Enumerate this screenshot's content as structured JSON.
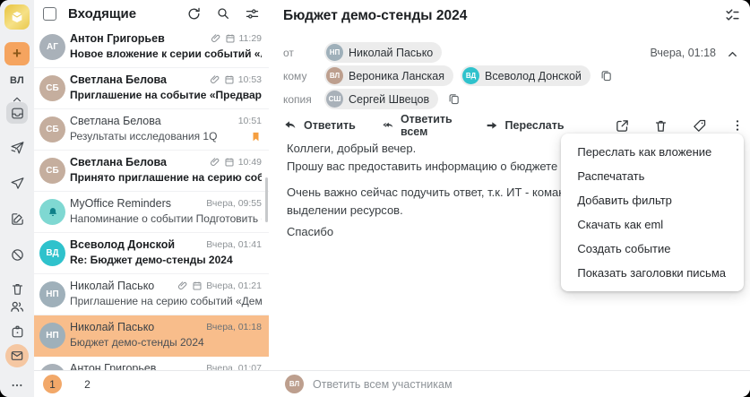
{
  "colors": {
    "accent_orange": "#f2a45f",
    "selected_row": "#f8bd8b",
    "teal_avatar": "#2fc2cc",
    "flag_orange": "#f59f40",
    "reminder_bg": "#7fd8d2",
    "pagination_active": "#f2a869"
  },
  "sidebar": {
    "compose": "+",
    "account_initials": "ВЛ"
  },
  "list": {
    "title": "Входящие",
    "emails": [
      {
        "name": "Антон Григорьев",
        "time": "11:29",
        "subject": "Новое вложение к серии событий «Аналити...",
        "unread": true,
        "attachment": true,
        "event": true,
        "avatar": "АГ"
      },
      {
        "name": "Светлана Белова",
        "time": "10:53",
        "subject": "Приглашение на событие «Предварительно...",
        "unread": true,
        "attachment": true,
        "event": true,
        "avatar": "СБ"
      },
      {
        "name": "Светлана Белова",
        "time": "10:51",
        "subject": "Результаты исследования 1Q",
        "unread": false,
        "flagged": true,
        "avatar": "СБ"
      },
      {
        "name": "Светлана Белова",
        "time": "10:49",
        "subject": "Принято приглашение на серию событий «...",
        "unread": true,
        "attachment": true,
        "event": true,
        "avatar": "СБ"
      },
      {
        "name": "MyOffice Reminders",
        "time": "Вчера, 09:55",
        "subject": "Напоминание о событии Подготовить отчет...",
        "unread": false,
        "avatar": "bell"
      },
      {
        "name": "Всеволод Донской",
        "time": "Вчера, 01:41",
        "subject": "Re: Бюджет демо-стенды 2024",
        "unread": true,
        "avatar": "ВД"
      },
      {
        "name": "Николай Пасько",
        "time": "Вчера, 01:21",
        "subject": "Приглашение на серию событий «Демо стен...",
        "unread": false,
        "attachment": true,
        "event": true,
        "avatar": "НП"
      },
      {
        "name": "Николай Пасько",
        "time": "Вчера, 01:18",
        "subject": "Бюджет демо-стенды 2024",
        "unread": false,
        "selected": true,
        "avatar": "НП"
      },
      {
        "name": "Антон Григорьев",
        "time": "Вчера, 01:07",
        "subject": "",
        "unread": false,
        "avatar": "АГ"
      }
    ],
    "pagination": {
      "pages": [
        "1",
        "2"
      ],
      "current": "1"
    }
  },
  "reader": {
    "subject": "Бюджет демо-стенды 2024",
    "date": "Вчера, 01:18",
    "from_label": "от",
    "to_label": "кому",
    "cc_label": "копия",
    "from": {
      "name": "Николай Пасько",
      "initials": "НП"
    },
    "to": [
      {
        "name": "Вероника Ланская",
        "initials": "ВЛ"
      },
      {
        "name": "Всеволод Донской",
        "initials": "ВД"
      }
    ],
    "cc": [
      {
        "name": "Сергей Швецов",
        "initials": "СШ"
      }
    ],
    "actions": {
      "reply": "Ответить",
      "reply_all": "Ответить всем",
      "forward": "Переслать"
    },
    "body_lines": [
      "Коллеги, добрый вечер.",
      "Прошу вас предоставить информацию о бюджете на наши демонстраци",
      "Очень важно сейчас подучить ответ, т.к. ИТ - команда Всеволода, уже",
      "выделении ресурсов.",
      "Спасибо"
    ],
    "menu_items": [
      "Переслать как вложение",
      "Распечатать",
      "Добавить фильтр",
      "Скачать как eml",
      "Создать событие",
      "Показать заголовки письма"
    ],
    "reply_bar": {
      "placeholder": "Ответить всем участникам",
      "avatar_initials": "ВЛ"
    }
  }
}
